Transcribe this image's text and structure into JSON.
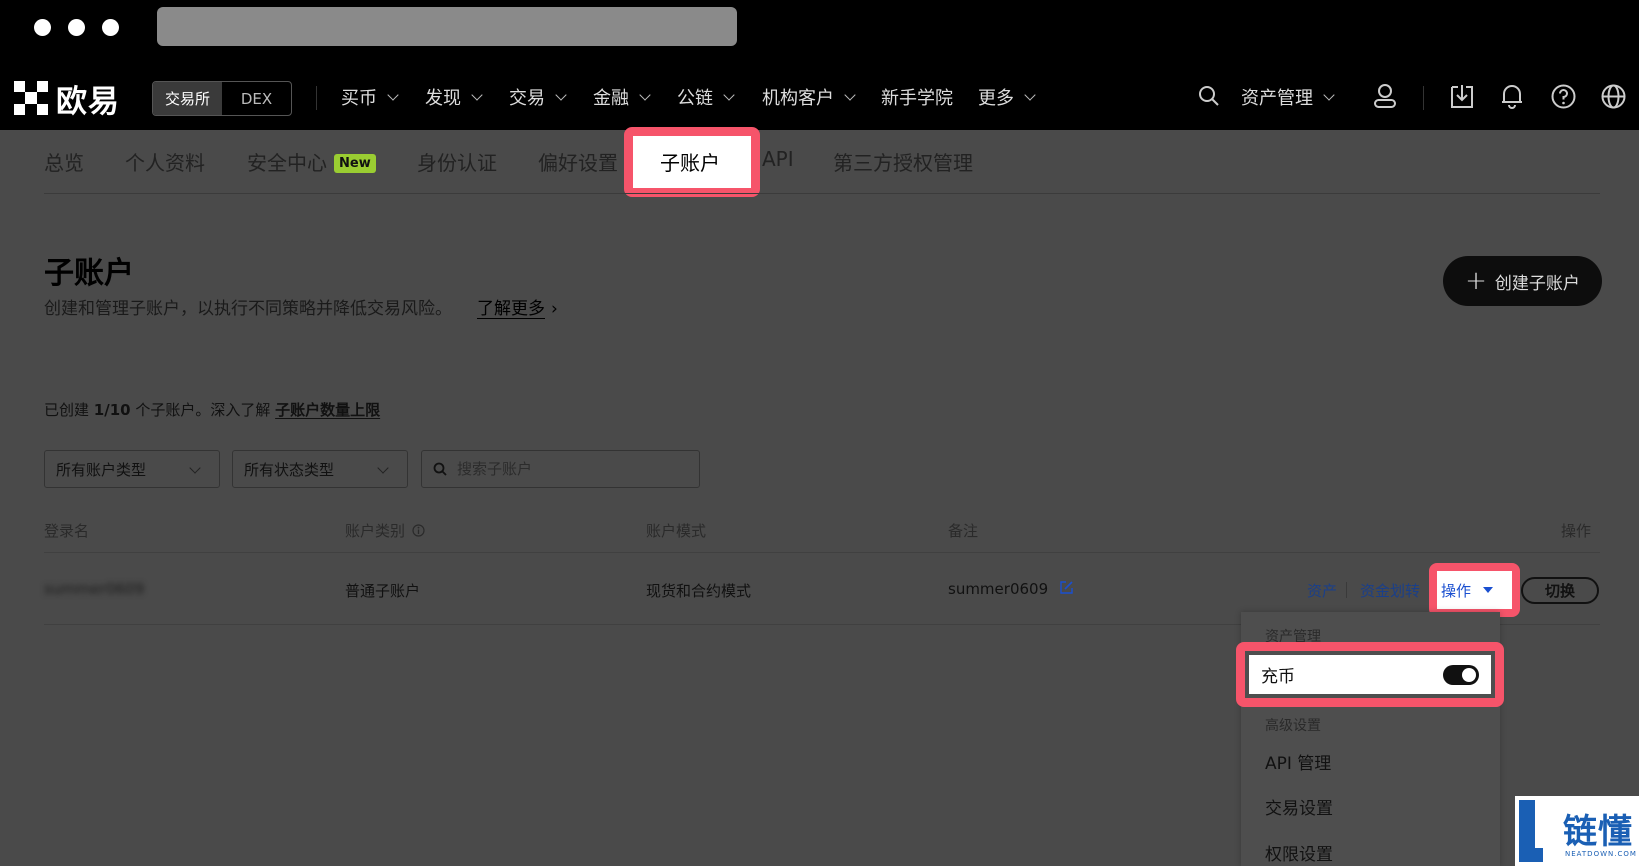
{
  "nav": {
    "logo_text": "欧易",
    "switch": [
      "交易所",
      "DEX"
    ],
    "menus": [
      "买币",
      "发现",
      "交易",
      "金融",
      "公链",
      "机构客户",
      "新手学院",
      "更多"
    ],
    "asset_mgmt": "资产管理"
  },
  "subtabs": [
    "总览",
    "个人资料",
    "安全中心",
    "身份认证",
    "偏好设置",
    "子账户",
    "API",
    "第三方授权管理"
  ],
  "new_badge": "New",
  "page": {
    "title": "子账户",
    "desc": "创建和管理子账户，以执行不同策略并降低交易风险。",
    "learn_more": "了解更多",
    "create_btn": "创建子账户"
  },
  "quota": {
    "prefix": "已创建 ",
    "count": "1/10",
    "mid": " 个子账户。深入了解 ",
    "link": "子账户数量上限"
  },
  "filters": {
    "account_type": "所有账户类型",
    "status_type": "所有状态类型",
    "search_placeholder": "搜索子账户"
  },
  "table": {
    "headers": [
      "登录名",
      "账户类别",
      "账户模式",
      "备注",
      "操作"
    ],
    "row": {
      "login": "summer0609",
      "category": "普通子账户",
      "mode": "现货和合约模式",
      "note": "summer0609",
      "asset_link": "资产",
      "transfer_link": "资金划转",
      "ops": "操作",
      "switch": "切换"
    }
  },
  "dropdown": {
    "section1": "资产管理",
    "deposit": "充币",
    "deposit_enabled": true,
    "section2": "高级设置",
    "items": [
      "API 管理",
      "交易设置",
      "权限设置"
    ]
  },
  "watermark": {
    "text": "链懂",
    "sub": "NEATDOWN.COM"
  },
  "colors": {
    "highlight": "#f6546a",
    "link": "#1a4fd0",
    "badge": "#9acd32"
  }
}
